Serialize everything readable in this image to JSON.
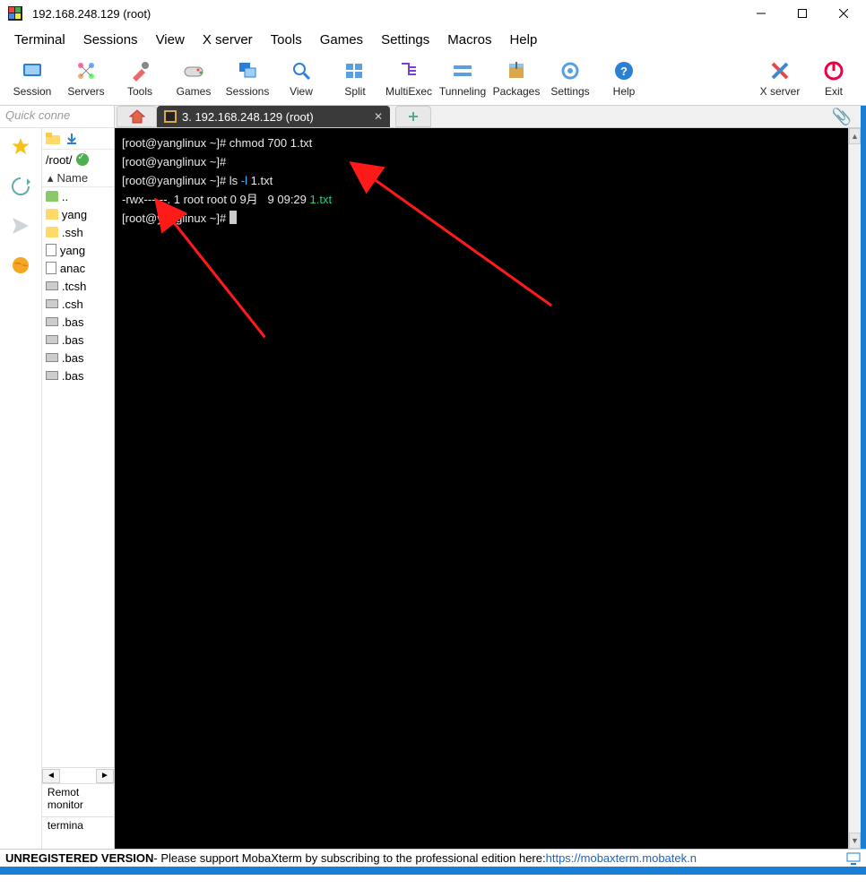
{
  "window": {
    "title": "192.168.248.129 (root)"
  },
  "menubar": [
    "Terminal",
    "Sessions",
    "View",
    "X server",
    "Tools",
    "Games",
    "Settings",
    "Macros",
    "Help"
  ],
  "toolbar": [
    {
      "label": "Session",
      "icon": "session"
    },
    {
      "label": "Servers",
      "icon": "servers"
    },
    {
      "label": "Tools",
      "icon": "tools"
    },
    {
      "label": "Games",
      "icon": "games"
    },
    {
      "label": "Sessions",
      "icon": "sessions"
    },
    {
      "label": "View",
      "icon": "view"
    },
    {
      "label": "Split",
      "icon": "split"
    },
    {
      "label": "MultiExec",
      "icon": "multiexec"
    },
    {
      "label": "Tunneling",
      "icon": "tunneling"
    },
    {
      "label": "Packages",
      "icon": "packages"
    },
    {
      "label": "Settings",
      "icon": "settings"
    },
    {
      "label": "Help",
      "icon": "help"
    }
  ],
  "toolbar_right": [
    {
      "label": "X server",
      "icon": "xserver"
    },
    {
      "label": "Exit",
      "icon": "exit"
    }
  ],
  "sidebar": {
    "quick_connect_placeholder": "Quick conne"
  },
  "tab": {
    "label": "3. 192.168.248.129 (root)"
  },
  "filetree": {
    "path": "/root/",
    "header_name": "Name",
    "items": [
      {
        "name": "..",
        "type": "folder-up"
      },
      {
        "name": "yang",
        "type": "folder"
      },
      {
        "name": ".ssh",
        "type": "folder"
      },
      {
        "name": "yang",
        "type": "file"
      },
      {
        "name": "anac",
        "type": "file"
      },
      {
        "name": ".tcsh",
        "type": "hidden"
      },
      {
        "name": ".csh",
        "type": "hidden"
      },
      {
        "name": ".bas",
        "type": "hidden"
      },
      {
        "name": ".bas",
        "type": "hidden"
      },
      {
        "name": ".bas",
        "type": "hidden"
      },
      {
        "name": ".bas",
        "type": "hidden"
      }
    ],
    "bottom1": "Remot monitor",
    "bottom2": "termina"
  },
  "terminal": {
    "lines": [
      {
        "prompt": "[root@yanglinux ~]# ",
        "cmd": "chmod 700 1.txt"
      },
      {
        "prompt": "[root@yanglinux ~]# ",
        "cmd": ""
      },
      {
        "prompt": "[root@yanglinux ~]# ",
        "cmd_pre": "ls ",
        "flag": "-l",
        "cmd_post": " 1.txt"
      },
      {
        "raw_pre": "-rwx------. 1 root root 0 9月   9 09:29 ",
        "fname": "1.txt"
      },
      {
        "prompt": "[root@yanglinux ~]# ",
        "cursor": true
      }
    ]
  },
  "footer": {
    "bold": "UNREGISTERED VERSION",
    "mid": "  -  Please support MobaXterm by subscribing to the professional edition here:  ",
    "link": "https://mobaxterm.mobatek.n"
  }
}
